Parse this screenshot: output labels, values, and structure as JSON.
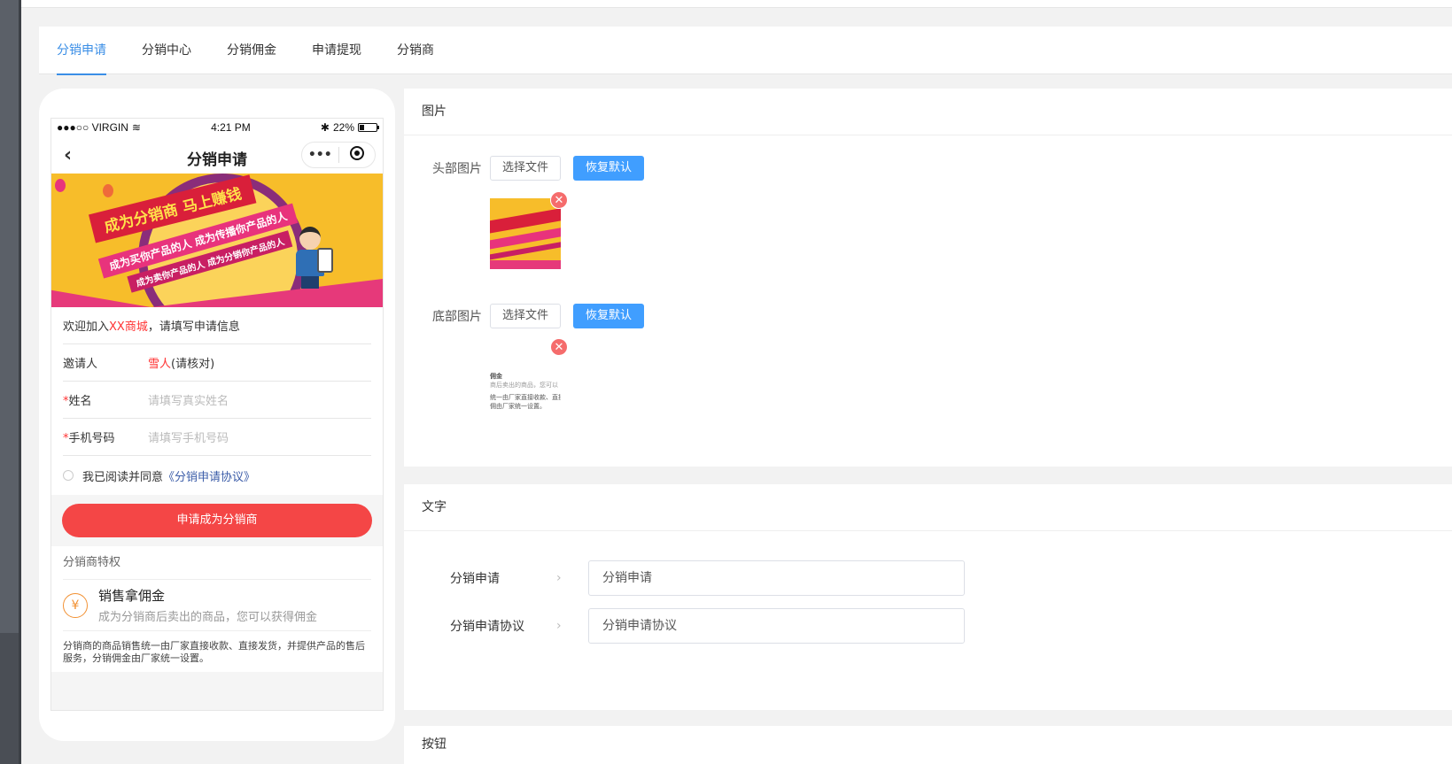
{
  "tabs": [
    "分销申请",
    "分销中心",
    "分销佣金",
    "申请提现",
    "分销商"
  ],
  "preview": {
    "status": {
      "carrier": "●●●○○ VIRGIN",
      "time": "4:21 PM",
      "battery": "22%"
    },
    "nav_title": "分销申请",
    "banner": {
      "headline": "成为分销商  马上赚钱",
      "line2": "成为买你产品的人 成为传播你产品的人",
      "line3": "成为卖你产品的人 成为分销你产品的人"
    },
    "welcome_prefix": "欢迎加入",
    "welcome_shop": "XX商城",
    "welcome_suffix": "，请填写申请信息",
    "inviter_label": "邀请人",
    "inviter_name": "雪人",
    "inviter_note": "(请核对)",
    "name_label": "姓名",
    "name_placeholder": "请填写真实姓名",
    "phone_label": "手机号码",
    "phone_placeholder": "请填写手机号码",
    "agree_text": "我已阅读并同意",
    "agree_link": "《分销申请协议》",
    "apply_button": "申请成为分销商",
    "privilege_title": "分销商特权",
    "privilege_item_title": "销售拿佣金",
    "privilege_item_desc": "成为分销商后卖出的商品，您可以获得佣金",
    "privilege_note": "分销商的商品销售统一由厂家直接收款、直接发货，并提供产品的售后服务，分销佣金由厂家统一设置。"
  },
  "image_panel": {
    "title": "图片",
    "rows": [
      {
        "label": "头部图片",
        "choose": "选择文件",
        "reset": "恢复默认"
      },
      {
        "label": "底部图片",
        "choose": "选择文件",
        "reset": "恢复默认"
      }
    ],
    "footer_thumb_text": [
      "佣金",
      "商后卖出的商品，您可以",
      "统一由厂家直接收款、直接发",
      "佣由厂家统一设置。"
    ]
  },
  "text_panel": {
    "title": "文字",
    "rows": [
      {
        "label": "分销申请",
        "value": "分销申请"
      },
      {
        "label": "分销申请协议",
        "value": "分销申请协议"
      }
    ]
  },
  "button_panel": {
    "title": "按钮"
  },
  "colors": {
    "accent": "#3a8ee6",
    "primary_button": "#409eff",
    "apply_red": "#f44646",
    "remove_red": "#f56c6c"
  }
}
